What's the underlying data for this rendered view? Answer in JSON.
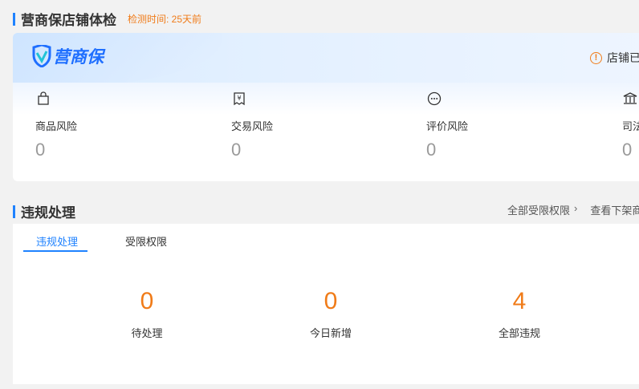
{
  "header": {
    "title": "营商保店铺体检",
    "check_time": "检测时间: 25天前"
  },
  "banner": {
    "logo_text": "营商保",
    "store_status": "店铺已"
  },
  "risks": [
    {
      "label": "商品风险",
      "value": "0",
      "icon": "shopping-bag-icon"
    },
    {
      "label": "交易风险",
      "value": "0",
      "icon": "yuan-receipt-icon"
    },
    {
      "label": "评价风险",
      "value": "0",
      "icon": "chat-bubble-icon"
    },
    {
      "label": "司法",
      "value": "0",
      "icon": "courthouse-icon"
    }
  ],
  "violation": {
    "title": "违规处理",
    "links": {
      "all_restricted": "全部受限权限",
      "view_delisted": "查看下架商品"
    },
    "tabs": [
      {
        "label": "违规处理"
      },
      {
        "label": "受限权限"
      }
    ],
    "stats": [
      {
        "value": "0",
        "label": "待处理"
      },
      {
        "value": "0",
        "label": "今日新增"
      },
      {
        "value": "4",
        "label": "全部违规"
      }
    ]
  },
  "colors": {
    "accent": "#1f82ff",
    "warning": "#f07b18",
    "muted": "#9a9a9a"
  }
}
